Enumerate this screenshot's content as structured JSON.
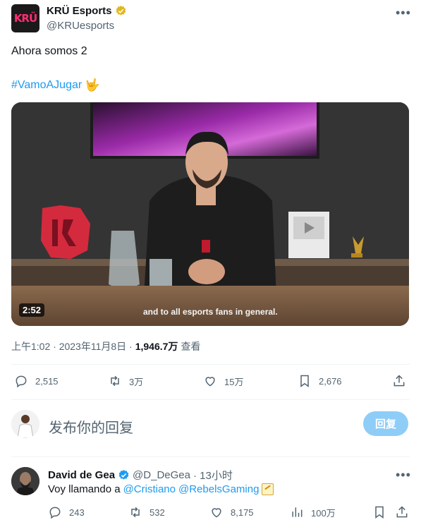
{
  "author": {
    "name": "KRÜ Esports",
    "handle": "@KRUesports",
    "logo_text": "KRÜ",
    "verified_color": "#e2b719"
  },
  "tweet": {
    "text": "Ahora somos 2",
    "hashtag": "#VamoAJugar",
    "hashtag_emoji": "🤟"
  },
  "media": {
    "duration": "2:52",
    "subtitle": "and to all esports fans in general."
  },
  "meta": {
    "time": "上午1:02 · 2023年11月8日 · ",
    "views": "1,946.7万",
    "views_label": "查看"
  },
  "actions": {
    "replies": "2,515",
    "retweets": "3万",
    "likes": "15万",
    "bookmarks": "2,676"
  },
  "composer": {
    "placeholder": "发布你的回复",
    "button_label": "回复"
  },
  "reply": {
    "name": "David de Gea",
    "handle": "@D_DeGea",
    "time": "· 13小时",
    "text_prefix": "Voy llamando a",
    "mention1": "@Cristiano",
    "mention2": "@RebelsGaming",
    "replies": "243",
    "retweets": "532",
    "likes": "8,175",
    "views": "100万"
  },
  "colors": {
    "accent": "#1d9bf0",
    "muted": "#536471",
    "verified_blue": "#1d9bf0"
  }
}
